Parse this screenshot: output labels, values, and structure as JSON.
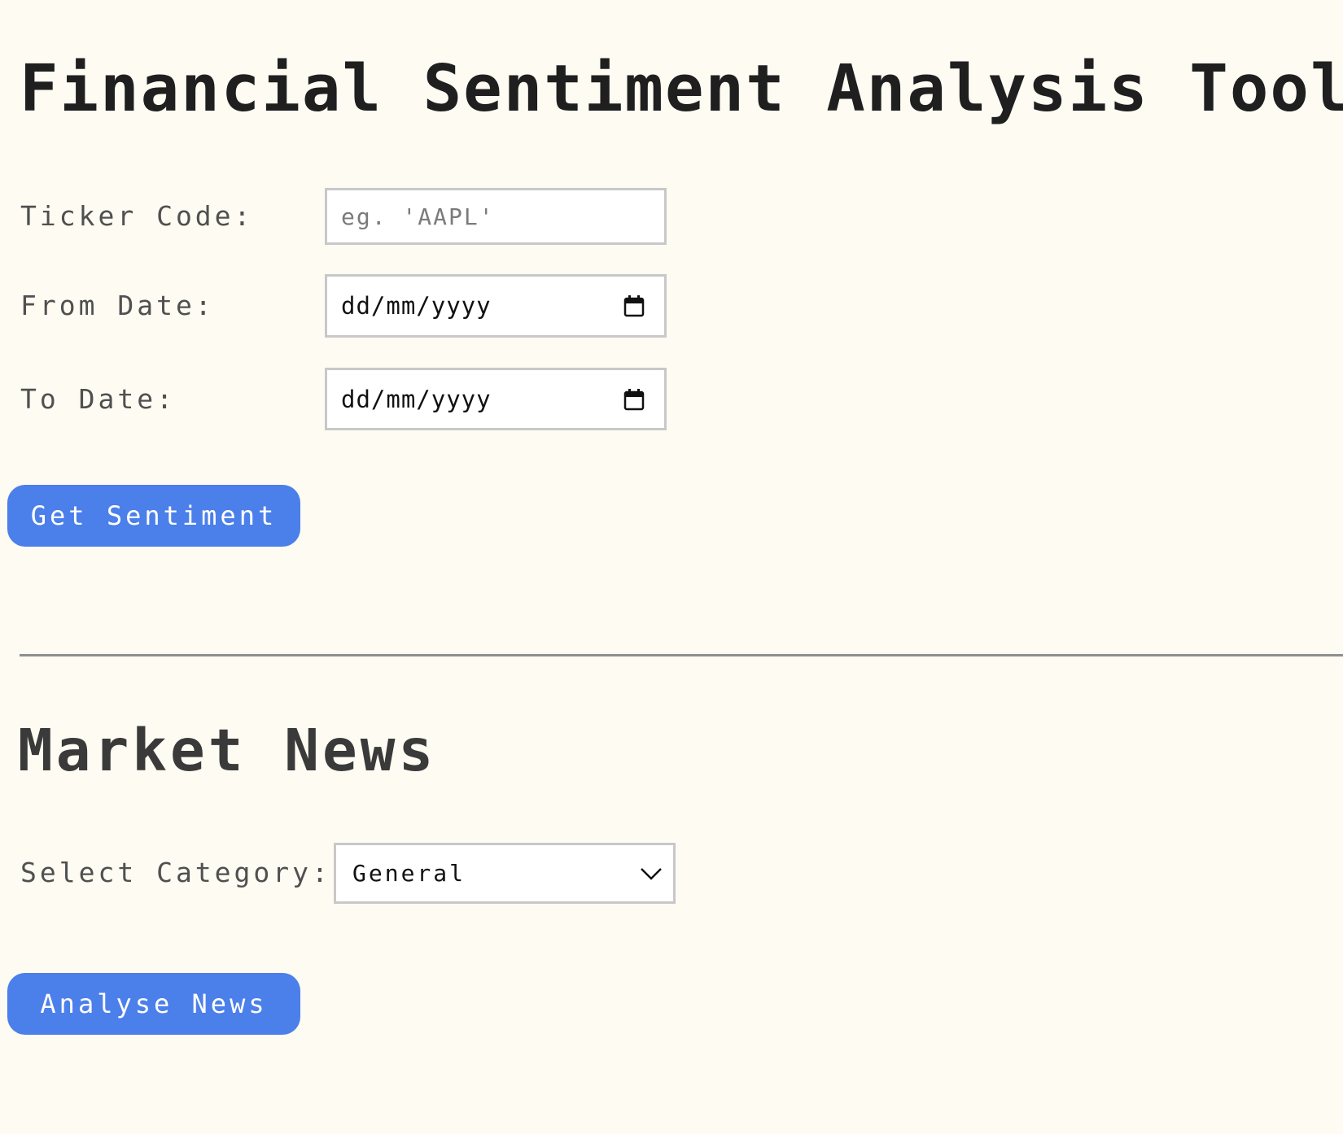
{
  "page": {
    "title": "Financial Sentiment Analysis Tool"
  },
  "sentiment_form": {
    "ticker_label": "Ticker Code:",
    "ticker_placeholder": "eg. 'AAPL'",
    "ticker_value": "",
    "from_date_label": "From Date:",
    "from_date_value": "dd/mm/yyyy",
    "to_date_label": "To Date:",
    "to_date_value": "dd/mm/yyyy",
    "submit_label": "Get Sentiment"
  },
  "market_news": {
    "title": "Market News",
    "category_label": "Select Category:",
    "category_selected": "General",
    "submit_label": "Analyse News"
  },
  "icons": {
    "date_picker": "calendar-icon",
    "select_arrow": "chevron-down-icon"
  },
  "colors": {
    "background": "#fdfbf2",
    "button": "#4b7fea",
    "button_text": "#ffffff",
    "input_border": "#c8c8c8",
    "divider": "#8e9090"
  }
}
